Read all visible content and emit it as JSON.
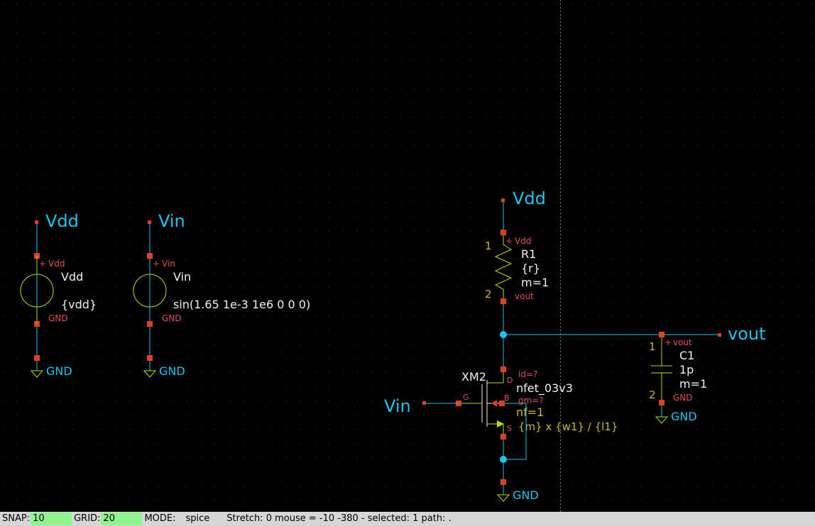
{
  "schematic": {
    "colors": {
      "wire": "#18c6f0",
      "pin": "#e04020",
      "symbol": "#b8e000",
      "label": "#f0f0f0",
      "netlabel": "#18c6f0",
      "pin_text": "#e05050",
      "pin_num": "#c8b820",
      "grid_dot": "#444",
      "background": "#000000"
    },
    "net_labels": {
      "vdd_left": "Vdd",
      "vin_left": "Vin",
      "vdd_top": "Vdd",
      "vout": "vout",
      "vin_gate": "Vin",
      "gnd1": "GND",
      "gnd2": "GND",
      "gnd3": "GND",
      "gnd4": "GND"
    },
    "v1": {
      "name": "Vdd",
      "value": "{vdd}",
      "pin_plus": "Vdd",
      "pin_minus": "GND",
      "plus": "+"
    },
    "v2": {
      "name": "Vin",
      "value": "sin(1.65 1e-3 1e6 0 0 0)",
      "pin_plus": "Vin",
      "pin_minus": "GND",
      "plus": "+"
    },
    "r1": {
      "name": "R1",
      "value": "{r}",
      "mult": "m=1",
      "pin1_num": "1",
      "pin2_num": "2",
      "pin1_net": "Vdd",
      "pin2_net": "vout",
      "plus": "+"
    },
    "c1": {
      "name": "C1",
      "value": "1p",
      "mult": "m=1",
      "pin1_num": "1",
      "pin2_num": "2",
      "pin1_net": "vout",
      "pin2_net": "GND",
      "plus": "+"
    },
    "xm2": {
      "name": "XM2",
      "model": "nfet_03v3",
      "id": "id=?",
      "gm": "gm=?",
      "nf": "nf=1",
      "expr": "{m} x {w1} / {l1}",
      "pin_d": "D",
      "pin_g": "G",
      "pin_b": "B",
      "pin_s": "S"
    }
  },
  "statusbar": {
    "snap_label": "SNAP:",
    "snap_value": "10",
    "grid_label": "GRID:",
    "grid_value": "20",
    "mode_label": "MODE:",
    "mode_value": "spice",
    "info": "Stretch: 0  mouse = -10 -380 - selected: 1 path: ."
  }
}
